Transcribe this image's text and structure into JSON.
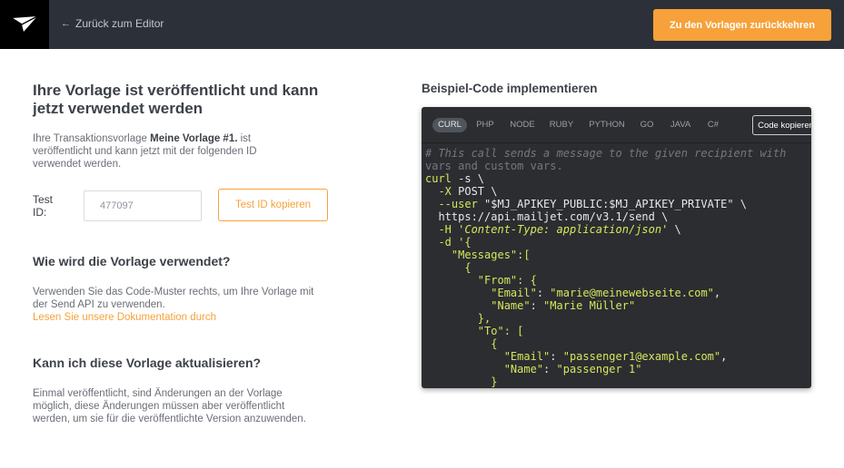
{
  "header": {
    "back_label": "Zurück zum Editor",
    "return_button": "Zu den Vorlagen zurückkehren"
  },
  "left": {
    "title": "Ihre Vorlage ist veröffentlicht und kann jetzt verwendet werden",
    "intro_prefix": "Ihre Transaktionsvorlage ",
    "intro_template_name": "Meine Vorlage #1.",
    "intro_suffix": " ist veröffentlicht und kann jetzt mit der folgenden ID verwendet werden.",
    "test_id_label": "Test ID:",
    "test_id_value": "477097",
    "copy_id_button": "Test ID kopieren",
    "section2_title": "Wie wird die Vorlage verwendet?",
    "section2_text": "Verwenden Sie das Code-Muster rechts, um Ihre Vorlage mit der Send API zu verwenden.",
    "section2_link": "Lesen Sie unsere Dokumentation durch",
    "section3_title": "Kann ich diese Vorlage aktualisieren?",
    "section3_text": "Einmal veröffentlicht, sind Änderungen an der Vorlage möglich, diese Änderungen müssen aber veröffentlicht werden, um sie für die veröffentlichte Version anzuwenden."
  },
  "right": {
    "title": "Beispiel-Code implementieren",
    "tabs": [
      "CURL",
      "PHP",
      "NODE",
      "RUBY",
      "PYTHON",
      "GO",
      "JAVA",
      "C#"
    ],
    "active_tab": "CURL",
    "copy_button": "Code kopieren",
    "code": {
      "l1": "# This call sends a message to the given recipient with",
      "l2": "vars and custom vars.",
      "l3a": "curl",
      "l3b": " -s \\",
      "l4a": "  -X",
      "l4b": " POST \\",
      "l5a": "  --user",
      "l5b": " \"$MJ_APIKEY_PUBLIC:$MJ_APIKEY_PRIVATE\" \\",
      "l6": "  https://api.mailjet.com/v3.1/send \\",
      "l7a": "  -H",
      "l7b": " 'Content-Type: application/json'",
      "l7c": " \\",
      "l8a": "  -d",
      "l8b": " '{",
      "l9": "    \"Messages\":[",
      "l10": "      {",
      "l11a": "        \"From\"",
      "l11b": ": {",
      "l12a": "          \"Email\"",
      "l12b": ": ",
      "l12c": "\"marie@meinewebseite.com\"",
      "l12d": ",",
      "l13a": "          \"Name\"",
      "l13b": ": ",
      "l13c": "\"Marie Müller\"",
      "l14": "        },",
      "l15a": "        \"To\"",
      "l15b": ": [",
      "l16": "          {",
      "l17a": "            \"Email\"",
      "l17b": ": ",
      "l17c": "\"passenger1@example.com\"",
      "l17d": ",",
      "l18a": "            \"Name\"",
      "l18b": ": ",
      "l18c": "\"passenger 1\"",
      "l19": "          }"
    }
  }
}
